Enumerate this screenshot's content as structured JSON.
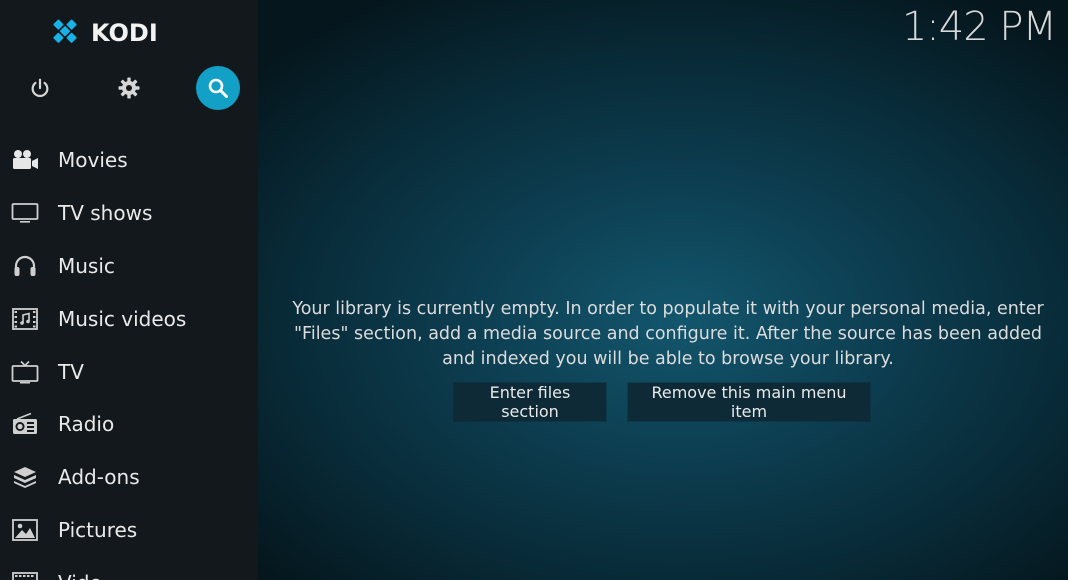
{
  "app": {
    "name": "KODI"
  },
  "clock": "1:42 PM",
  "top_icons": [
    {
      "name": "power-icon"
    },
    {
      "name": "gear-icon"
    },
    {
      "name": "search-icon",
      "active": true
    }
  ],
  "sidebar": {
    "items": [
      {
        "label": "Movies",
        "icon": "movie-camera-icon"
      },
      {
        "label": "TV shows",
        "icon": "monitor-icon"
      },
      {
        "label": "Music",
        "icon": "headphones-icon"
      },
      {
        "label": "Music videos",
        "icon": "music-video-icon"
      },
      {
        "label": "TV",
        "icon": "tv-icon"
      },
      {
        "label": "Radio",
        "icon": "radio-icon"
      },
      {
        "label": "Add-ons",
        "icon": "addons-box-icon"
      },
      {
        "label": "Pictures",
        "icon": "picture-icon"
      },
      {
        "label": "Vide",
        "icon": "video-icon"
      }
    ]
  },
  "main": {
    "message": "Your library is currently empty. In order to populate it with your personal media, enter \"Files\" section, add a media source and configure it. After the source has been added and indexed you will be able to browse your library.",
    "buttons": {
      "enter_files": "Enter files section",
      "remove_item": "Remove this main menu item"
    }
  },
  "colors": {
    "accent": "#12a0c7",
    "sidebar_bg": "#12181b",
    "logo_blue": "#17b2e7"
  }
}
